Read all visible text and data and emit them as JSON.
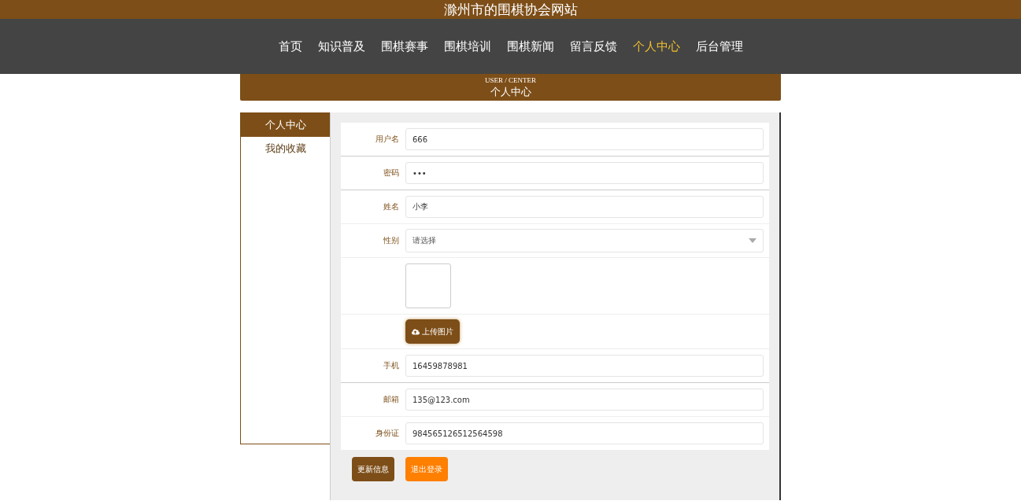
{
  "site_title": "滁州市的围棋协会网站",
  "nav": [
    {
      "label": "首页",
      "selected": false
    },
    {
      "label": "知识普及",
      "selected": false
    },
    {
      "label": "围棋赛事",
      "selected": false
    },
    {
      "label": "围棋培训",
      "selected": false
    },
    {
      "label": "围棋新闻",
      "selected": false
    },
    {
      "label": "留言反馈",
      "selected": false
    },
    {
      "label": "个人中心",
      "selected": true
    },
    {
      "label": "后台管理",
      "selected": false
    }
  ],
  "banner": {
    "subtitle": "USER / CENTER",
    "title": "个人中心"
  },
  "sidebar": [
    {
      "label": "个人中心",
      "selected": true
    },
    {
      "label": "我的收藏",
      "selected": false
    }
  ],
  "form": [
    {
      "kind": "text",
      "label": "用户名",
      "value": "666"
    },
    {
      "kind": "text",
      "label": "密码",
      "value": "•••"
    },
    {
      "kind": "text",
      "label": "姓名",
      "value": "小李"
    },
    {
      "kind": "select",
      "label": "性别",
      "value": "请选择"
    },
    {
      "kind": "image"
    },
    {
      "kind": "upload",
      "button": "上传图片"
    },
    {
      "kind": "text",
      "label": "手机",
      "value": "16459878981"
    },
    {
      "kind": "text",
      "label": "邮箱",
      "value": "135@123.com"
    },
    {
      "kind": "text",
      "label": "身份证",
      "value": "984565126512564598"
    }
  ],
  "buttons": [
    {
      "label": "更新信息",
      "kind": "primary"
    },
    {
      "label": "退出登录",
      "kind": "warning"
    }
  ]
}
